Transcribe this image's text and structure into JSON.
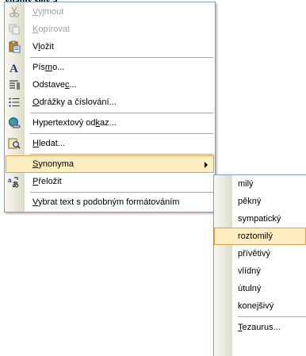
{
  "top_fragment": "ynamy slov a...",
  "menu": {
    "items": [
      {
        "label_pre": "",
        "label_ul": "V",
        "label_post": "yjmout",
        "icon": "scissors-icon",
        "disabled": true
      },
      {
        "label_pre": "",
        "label_ul": "K",
        "label_post": "opírovat",
        "icon": "copy-icon",
        "disabled": true
      },
      {
        "label_pre": "V",
        "label_ul": "l",
        "label_post": "ožit",
        "icon": "paste-icon",
        "disabled": false
      },
      {
        "label_pre": "Pís",
        "label_ul": "m",
        "label_post": "o...",
        "icon": "font-icon",
        "disabled": false
      },
      {
        "label_pre": "Odstave",
        "label_ul": "c",
        "label_post": "...",
        "icon": "paragraph-icon",
        "disabled": false
      },
      {
        "label_pre": "",
        "label_ul": "O",
        "label_post": "drážky a číslování...",
        "icon": "bullets-icon",
        "disabled": false
      },
      {
        "label_pre": "Hypertextový od",
        "label_ul": "k",
        "label_post": "az...",
        "icon": "hyperlink-icon",
        "disabled": false
      },
      {
        "label_pre": "",
        "label_ul": "H",
        "label_post": "ledat...",
        "icon": "research-icon",
        "disabled": false
      },
      {
        "label_pre": "",
        "label_ul": "S",
        "label_post": "ynonyma",
        "icon": "",
        "disabled": false
      },
      {
        "label_pre": "",
        "label_ul": "P",
        "label_post": "řeložit",
        "icon": "translate-icon",
        "disabled": false
      },
      {
        "label_pre": "",
        "label_ul": "V",
        "label_post": "ybrat text s podobným formátováním",
        "icon": "",
        "disabled": false
      }
    ]
  },
  "submenu": {
    "items": [
      "milý",
      "pěkný",
      "sympatický",
      "roztomilý",
      "přívětivý",
      "vlídný",
      "útulný",
      "konejšivý"
    ],
    "selected_index": 3,
    "thesaurus": {
      "label_ul": "T",
      "label_post": "ezaurus..."
    }
  },
  "colors": {
    "highlight": "#ffeec2",
    "highlight_border": "#e39d45",
    "menu_border": "#7f9db9",
    "disabled_text": "#a0a0a0"
  }
}
